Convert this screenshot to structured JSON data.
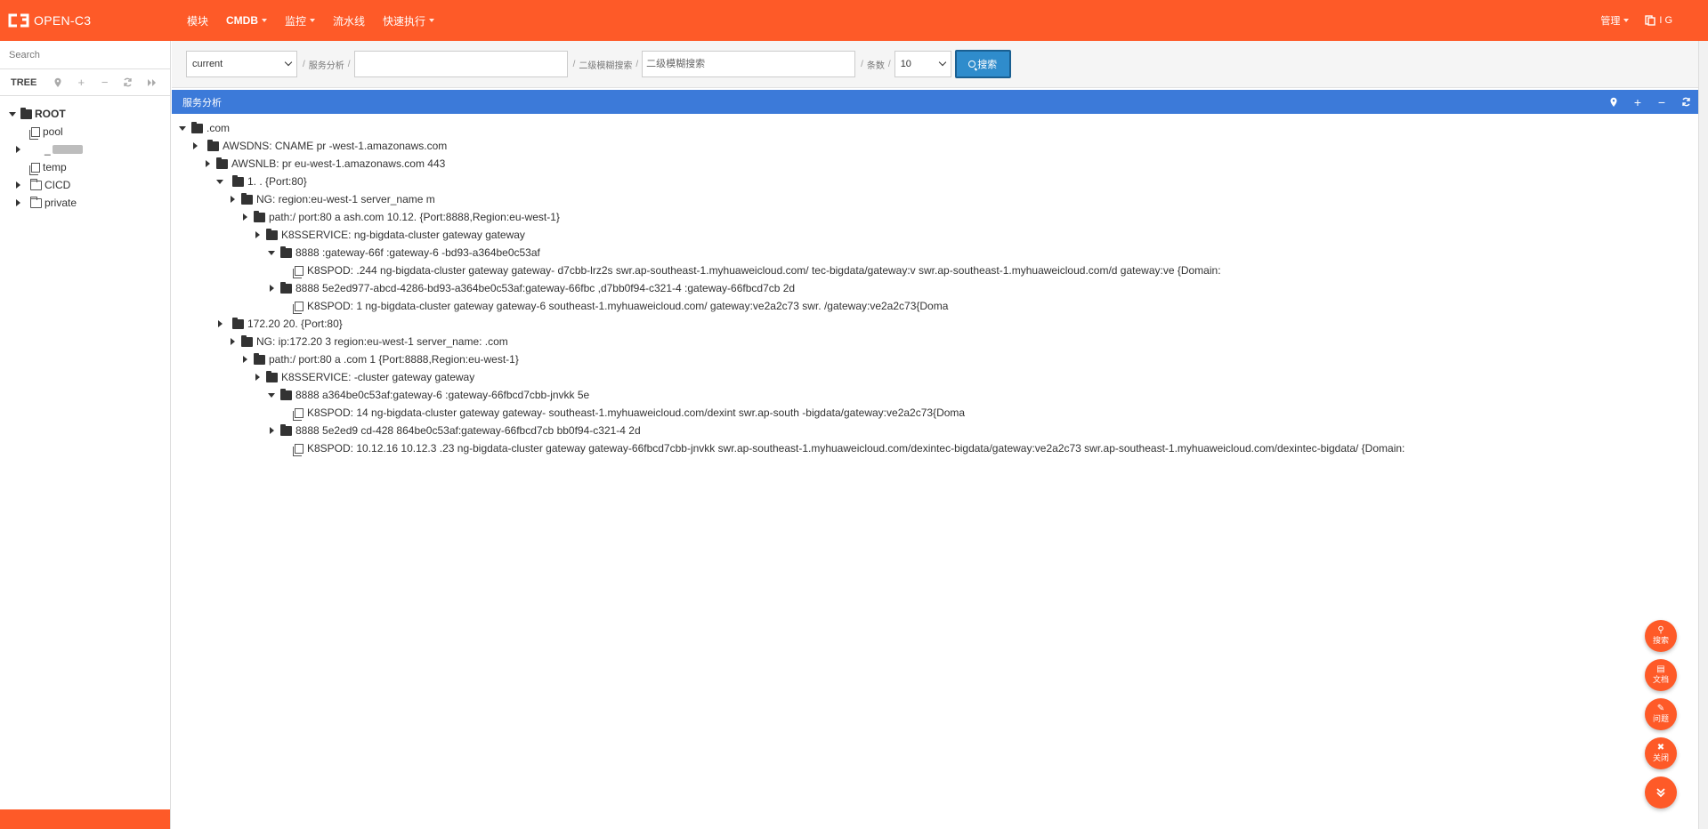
{
  "navbar": {
    "brand": "OPEN-C3",
    "menu": [
      {
        "label": "模块",
        "caret": false,
        "bold": false
      },
      {
        "label": "CMDB",
        "caret": true,
        "bold": true
      },
      {
        "label": "监控",
        "caret": true,
        "bold": false
      },
      {
        "label": "流水线",
        "caret": false,
        "bold": false
      },
      {
        "label": "快速执行",
        "caret": true,
        "bold": false
      }
    ],
    "admin_label": "管理",
    "user_name": "I              G"
  },
  "sidebar": {
    "search_placeholder": "Search",
    "tree_title": "TREE",
    "tree": {
      "root": "ROOT",
      "children": [
        "pool",
        "_",
        "temp",
        "CICD",
        "private"
      ]
    }
  },
  "filters": {
    "env_value": "current",
    "service_label": "服务分析",
    "service_value": "              ",
    "second_label": "二级模糊搜索",
    "second_placeholder": "二级模糊搜索",
    "count_label": "条数",
    "count_value": "10",
    "search_button": "搜索"
  },
  "panel": {
    "title": "服务分析"
  },
  "service_tree": [
    {
      "text": "                      .com"
    },
    {
      "text": "AWSDNS: CNAME pr                                              -west-1.amazonaws.com"
    },
    {
      "text": "AWSNLB: pr                                         eu-west-1.amazonaws.com 443"
    },
    {
      "text": "1.             .                {Port:80}"
    },
    {
      "text": "NG:                         region:eu-west-1 server_name                          m"
    },
    {
      "text": "path:/ port:80 a                      ash.com 10.12.           {Port:8888,Region:eu-west-1}"
    },
    {
      "text": "K8SSERVICE: ng-bigdata-cluster gateway gateway"
    },
    {
      "text": "8888                                                         :gateway-66f                                    :gateway-6                                  -bd93-a364be0c53af"
    },
    {
      "text": "K8SPOD:                              .244 ng-bigdata-cluster gateway gateway-          d7cbb-lrz2s swr.ap-southeast-1.myhuaweicloud.com/              tec-bigdata/gateway:v                 swr.ap-southeast-1.myhuaweicloud.com/d              gateway:ve                 {Domain:"
    },
    {
      "text": "8888 5e2ed977-abcd-4286-bd93-a364be0c53af:gateway-66fbc              ,d7bb0f94-c321-4                           :gateway-66fbcd7cb                                                  2d"
    },
    {
      "text": "K8SPOD: 1                           ng-bigdata-cluster gateway gateway-6                           southeast-1.myhuaweicloud.com/                  gateway:ve2a2c73 swr.                                     /gateway:ve2a2c73{Doma"
    },
    {
      "text": "172.20                 20.     {Port:80}"
    },
    {
      "text": "NG: ip:172.20     3 region:eu-west-1 server_name:                         .com"
    },
    {
      "text": "path:/ port:80 a                         .com 1                 {Port:8888,Region:eu-west-1}"
    },
    {
      "text": "K8SSERVICE:       -cluster gateway gateway"
    },
    {
      "text": "8888                              a364be0c53af:gateway-6                                                              :gateway-66fbcd7cbb-jnvkk 5e"
    },
    {
      "text": "K8SPOD:                                14 ng-bigdata-cluster gateway gateway-                            southeast-1.myhuaweicloud.com/dexint                   swr.ap-south                       -bigdata/gateway:ve2a2c73{Doma"
    },
    {
      "text": "8888 5e2ed9          cd-428          864be0c53af:gateway-66fbcd7cb            bb0f94-c321-4                                              2d"
    },
    {
      "text": "K8SPOD: 10.12.16     10.12.3   .23   ng-bigdata-cluster gateway gateway-66fbcd7cbb-jnvkk swr.ap-southeast-1.myhuaweicloud.com/dexintec-bigdata/gateway:ve2a2c73 swr.ap-southeast-1.myhuaweicloud.com/dexintec-bigdata/          {Domain:"
    }
  ],
  "fabs": [
    {
      "icon": "search-icon",
      "label": "搜索"
    },
    {
      "icon": "book-icon",
      "label": "文档"
    },
    {
      "icon": "edit-icon",
      "label": "问题"
    },
    {
      "icon": "close-icon",
      "label": "关闭"
    },
    {
      "icon": "chevron-double-down-icon",
      "label": ""
    }
  ],
  "colors": {
    "brand": "#fe5a28",
    "panel_header": "#3c7ad9",
    "primary_button": "#2f8ccc"
  }
}
